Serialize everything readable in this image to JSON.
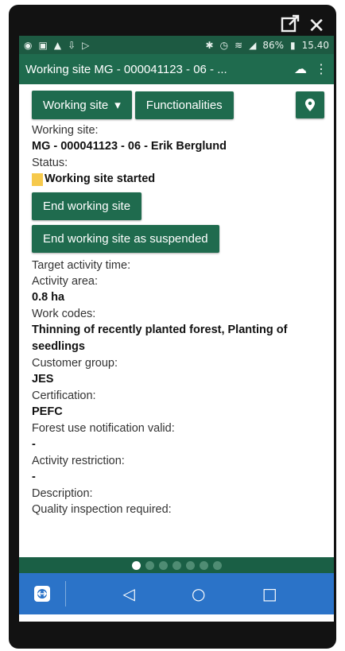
{
  "window_controls": {
    "popout_icon": "popout-icon",
    "close_glyph": "✕"
  },
  "status_bar": {
    "battery_percent": "86%",
    "time": "15.40"
  },
  "app_bar": {
    "title": "Working site MG - 000041123 - 06 - ..."
  },
  "toolbar": {
    "working_site_label": "Working site",
    "functionalities_label": "Functionalities"
  },
  "details": {
    "working_site_label": "Working site:",
    "working_site_value": "MG - 000041123 - 06 - Erik Berglund",
    "status_label": "Status:",
    "status_value": "Working site started",
    "end_button": "End working site",
    "end_suspended_button": "End working site as suspended",
    "target_time_label": "Target activity time:",
    "area_label": "Activity area:",
    "area_value": "0.8 ha",
    "work_codes_label": "Work codes:",
    "work_codes_value": "Thinning of recently planted forest, Planting of seedlings",
    "customer_group_label": "Customer group:",
    "customer_group_value": "JES",
    "certification_label": "Certification:",
    "certification_value": "PEFC",
    "forest_notice_label": "Forest use notification valid:",
    "forest_notice_value": "-",
    "restriction_label": "Activity restriction:",
    "restriction_value": "-",
    "description_label": "Description:",
    "quality_label": "Quality inspection required:"
  },
  "pager": {
    "page_count": 7,
    "active_index": 0
  },
  "colors": {
    "primary": "#1f6b4e",
    "status": "#f6c94b",
    "nav": "#2b73c8"
  }
}
